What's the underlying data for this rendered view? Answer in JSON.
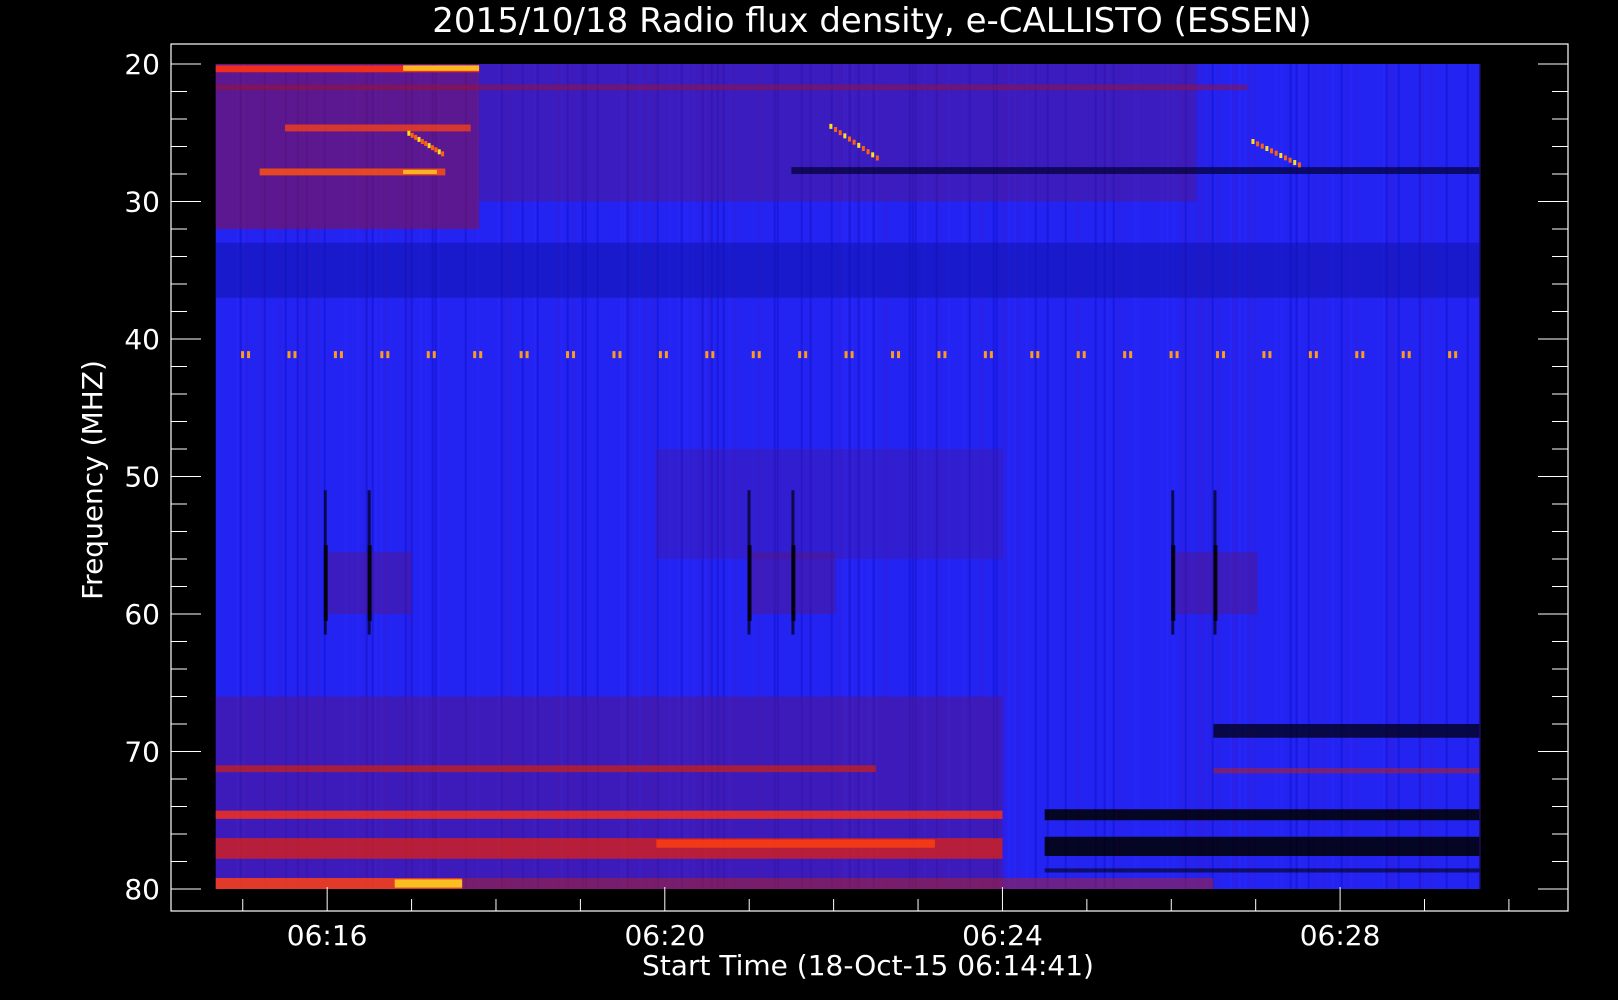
{
  "chart_data": {
    "type": "heatmap",
    "title": "2015/10/18  Radio flux density, e-CALLISTO (ESSEN)",
    "xlabel": "Start Time (18-Oct-15 06:14:41)",
    "ylabel": "Frequency (MHZ)",
    "x_ticks": [
      "06:16",
      "06:20",
      "06:24",
      "06:28"
    ],
    "x_tick_minutes": [
      16,
      20,
      24,
      28
    ],
    "y_ticks": [
      "20",
      "30",
      "40",
      "50",
      "60",
      "70",
      "80"
    ],
    "y_tick_values": [
      20,
      30,
      40,
      50,
      60,
      70,
      80
    ],
    "xlim_minutes": [
      14.15,
      30.7
    ],
    "ylim": [
      80,
      20
    ],
    "data_start_minute": 14.68,
    "data_end_minute": 29.65,
    "freq_range": [
      20,
      80
    ],
    "grid": false,
    "colormap": [
      "#000000",
      "#1a1aff",
      "#2020f0",
      "#8b1040",
      "#c81a1a",
      "#ff6a00",
      "#ffe000"
    ],
    "background_color": "#2323f2",
    "features": [
      {
        "name": "periodic-carrier",
        "freq": 41.1,
        "period_minutes": 0.55,
        "color": "#ff9a20"
      },
      {
        "name": "drifting-burst-1",
        "start_minute": 16.95,
        "end_minute": 17.35,
        "freq_start": 25.0,
        "freq_end": 26.5
      },
      {
        "name": "drifting-burst-2",
        "start_minute": 21.95,
        "end_minute": 22.5,
        "freq_start": 24.5,
        "freq_end": 26.8
      },
      {
        "name": "drifting-burst-3",
        "start_minute": 26.95,
        "end_minute": 27.5,
        "freq_start": 25.6,
        "freq_end": 27.3
      }
    ]
  }
}
